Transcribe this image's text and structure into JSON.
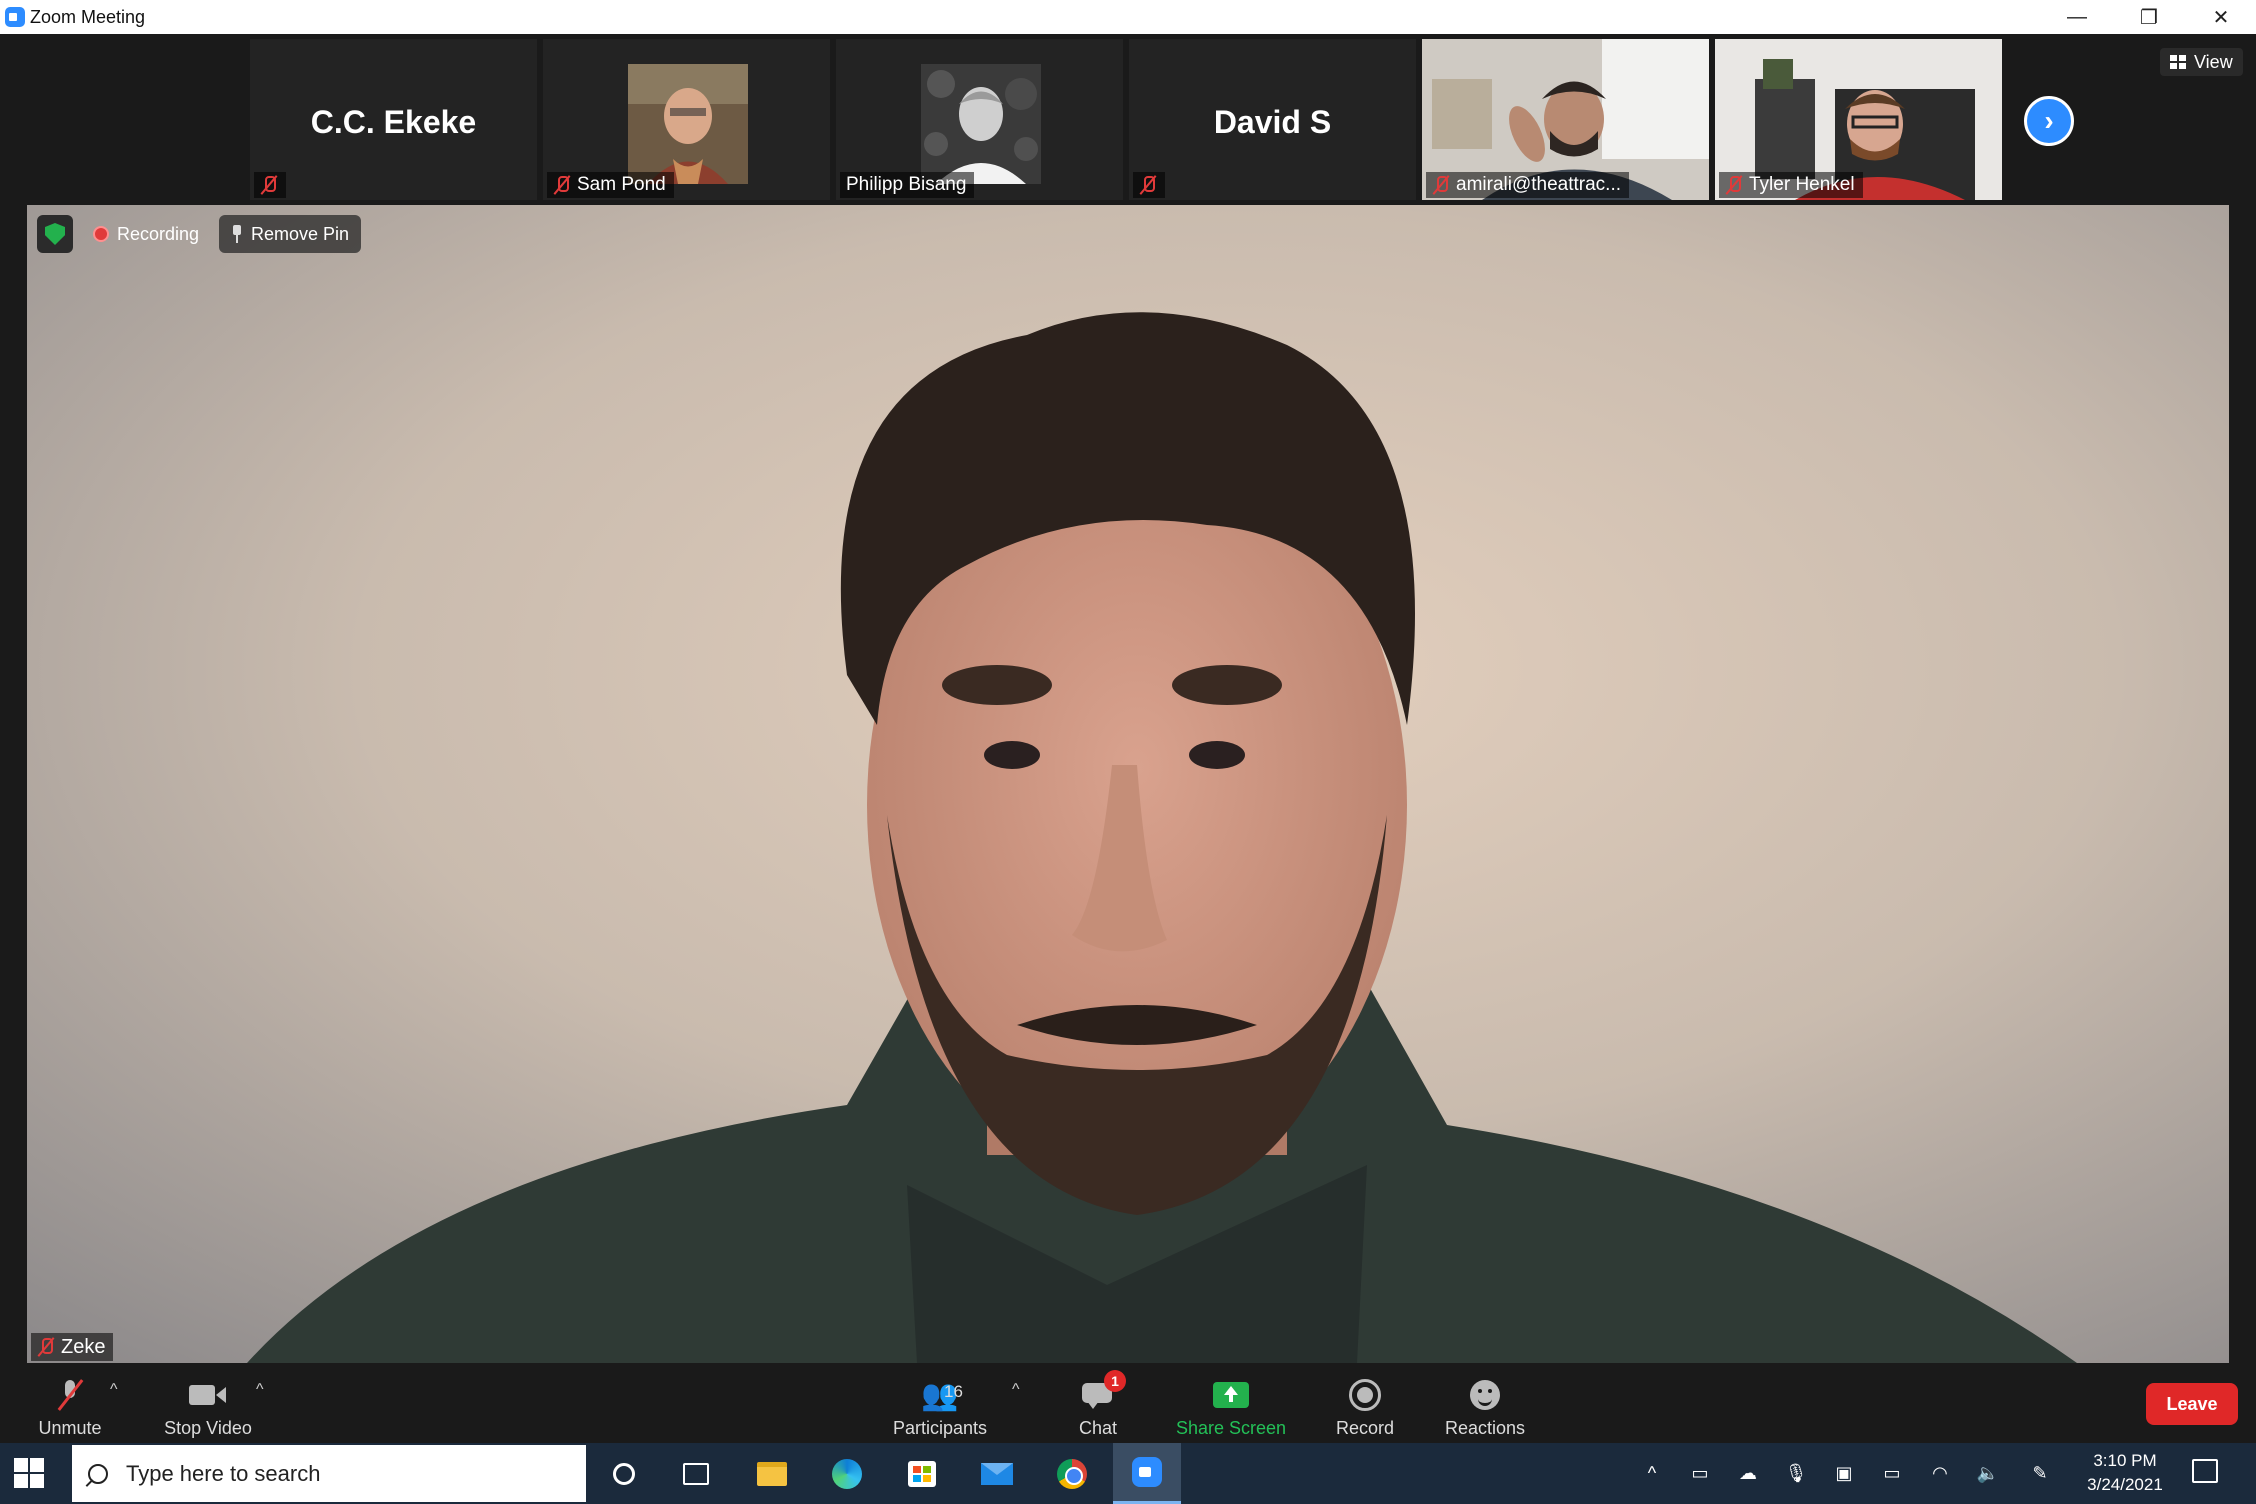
{
  "window": {
    "title": "Zoom Meeting"
  },
  "strip": {
    "tiles": [
      {
        "name": "C.C. Ekeke",
        "label": ""
      },
      {
        "name": "",
        "label": "Sam Pond"
      },
      {
        "name": "",
        "label": "Philipp Bisang"
      },
      {
        "name": "David S",
        "label": ""
      },
      {
        "name": "",
        "label": "amirali@theattrac..."
      },
      {
        "name": "",
        "label": "Tyler Henkel"
      }
    ],
    "view_label": "View"
  },
  "main": {
    "recording_label": "Recording",
    "remove_pin_label": "Remove Pin",
    "speaker_name": "Zeke"
  },
  "toolbar": {
    "unmute_label": "Unmute",
    "stop_video_label": "Stop Video",
    "participants_label": "Participants",
    "participants_count": "16",
    "chat_label": "Chat",
    "chat_badge": "1",
    "share_screen_label": "Share Screen",
    "record_label": "Record",
    "reactions_label": "Reactions",
    "leave_label": "Leave"
  },
  "taskbar": {
    "search_placeholder": "Type here to search",
    "time": "3:10 PM",
    "date": "3/24/2021"
  },
  "colors": {
    "accent": "#2d8cff",
    "leave": "#e02828",
    "share": "#23b14d",
    "muted": "#e03a3a"
  }
}
